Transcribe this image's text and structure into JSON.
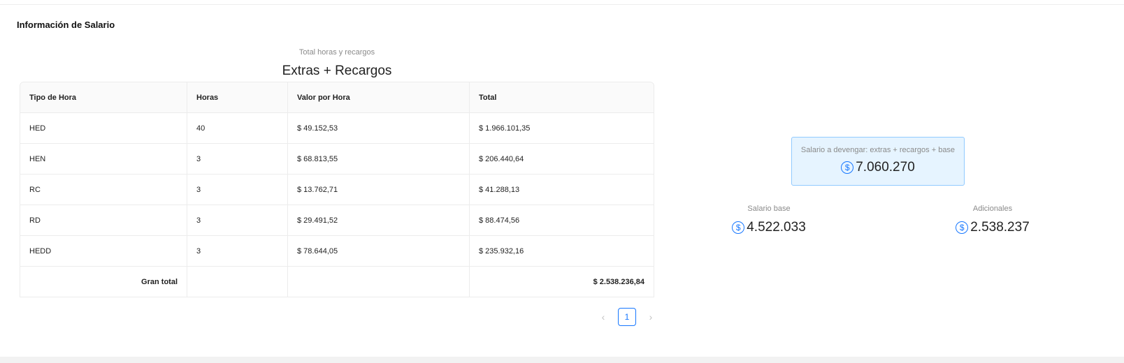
{
  "section": {
    "title": "Información de Salario"
  },
  "table_card": {
    "subtitle": "Total horas y recargos",
    "title": "Extras + Recargos",
    "columns": [
      "Tipo de Hora",
      "Horas",
      "Valor por Hora",
      "Total"
    ],
    "rows": [
      {
        "tipo": "HED",
        "horas": "40",
        "valor": "$ 49.152,53",
        "total": "$ 1.966.101,35"
      },
      {
        "tipo": "HEN",
        "horas": "3",
        "valor": "$ 68.813,55",
        "total": "$ 206.440,64"
      },
      {
        "tipo": "RC",
        "horas": "3",
        "valor": "$ 13.762,71",
        "total": "$ 41.288,13"
      },
      {
        "tipo": "RD",
        "horas": "3",
        "valor": "$ 29.491,52",
        "total": "$ 88.474,56"
      },
      {
        "tipo": "HEDD",
        "horas": "3",
        "valor": "$ 78.644,05",
        "total": "$ 235.932,16"
      }
    ],
    "grand_total_label": "Gran total",
    "grand_total_value": "$ 2.538.236,84"
  },
  "pagination": {
    "prev": "‹",
    "current_page": "1",
    "next": "›"
  },
  "summary": {
    "title": "Salario a devengar: extras + recargos + base",
    "value": "7.060.270",
    "currency_symbol": "$"
  },
  "salario_base": {
    "title": "Salario base",
    "value": "4.522.033",
    "currency_symbol": "$"
  },
  "adicionales": {
    "title": "Adicionales",
    "value": "2.538.237",
    "currency_symbol": "$"
  },
  "colors": {
    "accent": "#1677ff",
    "summary_bg": "#e6f4ff",
    "summary_border": "#91caff"
  },
  "icons": {
    "currency": "dollar-icon",
    "prev": "chevron-left-icon",
    "next": "chevron-right-icon"
  }
}
